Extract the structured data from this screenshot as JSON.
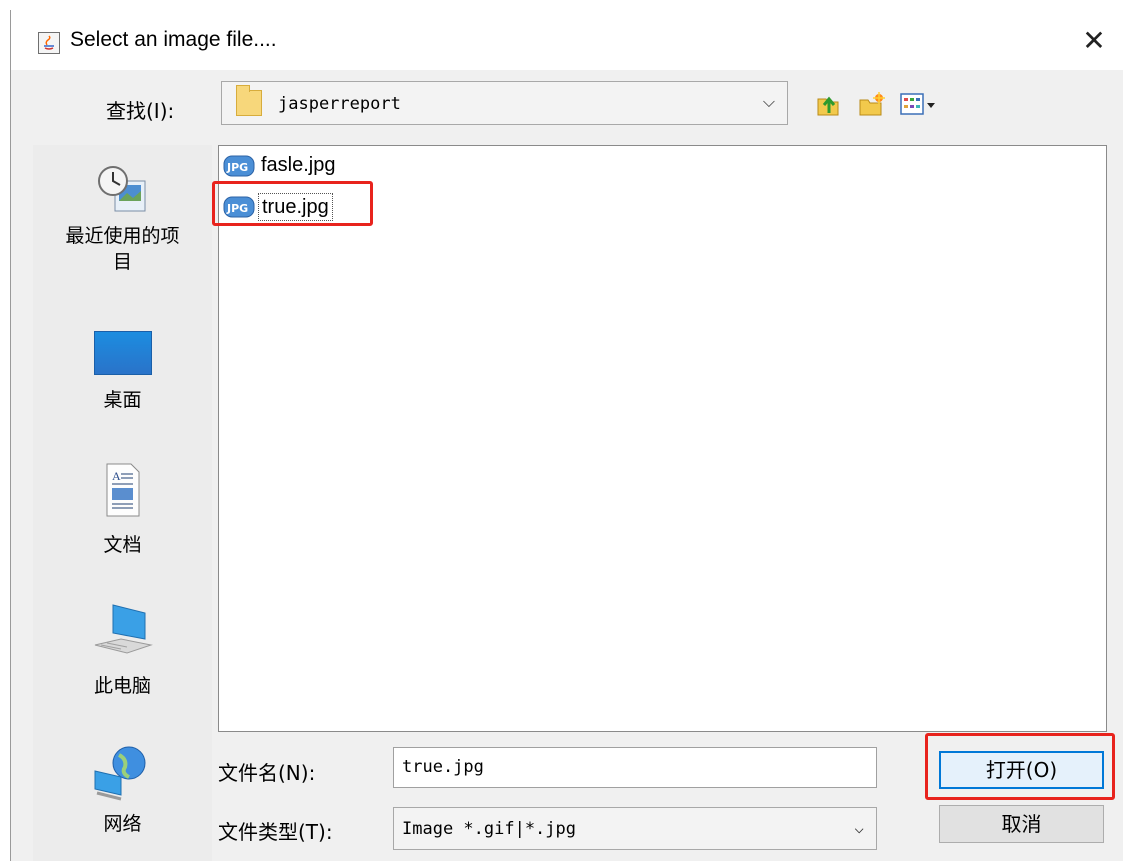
{
  "dialog": {
    "title": "Select an image file....",
    "close_glyph": "✕"
  },
  "look_in": {
    "label": "查找(I):",
    "value": "jasperreport",
    "arrow": "⌵"
  },
  "toolbar": {
    "up_icon": "up-folder-icon",
    "new_folder_icon": "new-folder-icon",
    "view_icon": "view-menu-icon"
  },
  "sidebar": {
    "items": [
      {
        "label_line1": "最近使用的项",
        "label_line2": "目",
        "icon": "recent-items-icon"
      },
      {
        "label": "桌面",
        "icon": "desktop-icon"
      },
      {
        "label": "文档",
        "icon": "documents-icon"
      },
      {
        "label": "此电脑",
        "icon": "this-pc-icon"
      },
      {
        "label": "网络",
        "icon": "network-icon"
      }
    ]
  },
  "files": [
    {
      "name": "fasle.jpg",
      "selected": false
    },
    {
      "name": "true.jpg",
      "selected": true
    }
  ],
  "filename": {
    "label": "文件名(N):",
    "value": "true.jpg"
  },
  "filetype": {
    "label": "文件类型(T):",
    "value": "Image *.gif|*.jpg",
    "arrow": "⌵"
  },
  "buttons": {
    "open": "打开(O)",
    "cancel": "取消"
  },
  "colors": {
    "highlight": "#e8231d",
    "focus": "#0078d7"
  }
}
